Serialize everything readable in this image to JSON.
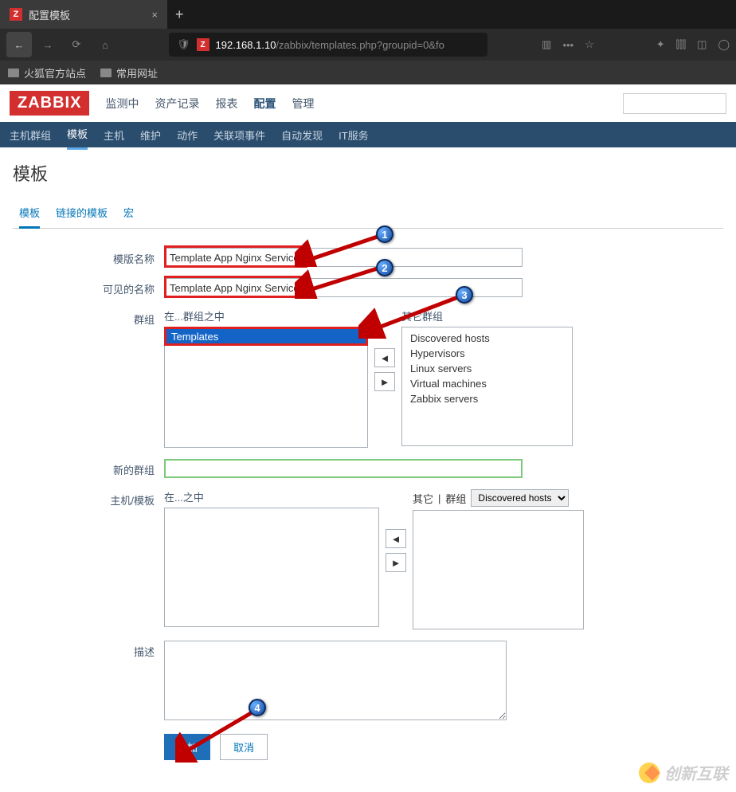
{
  "browser": {
    "tab_title": "配置模板",
    "url_host": "192.168.1.10",
    "url_path": "/zabbix/templates.php?groupid=0&fo",
    "bookmarks": [
      "火狐官方站点",
      "常用网址"
    ]
  },
  "zabbix": {
    "logo": "ZABBIX",
    "top_menu": [
      "监测中",
      "资产记录",
      "报表",
      "配置",
      "管理"
    ],
    "top_menu_active": 3,
    "sub_menu": [
      "主机群组",
      "模板",
      "主机",
      "维护",
      "动作",
      "关联项事件",
      "自动发现",
      "IT服务"
    ],
    "sub_menu_active": 1,
    "page_title": "模板",
    "form_tabs": [
      "模板",
      "链接的模板",
      "宏"
    ],
    "form_tabs_active": 0,
    "labels": {
      "template_name": "模版名称",
      "visible_name": "可见的名称",
      "groups": "群组",
      "in_groups": "在...群组之中",
      "other_groups": "其它群组",
      "new_group": "新的群组",
      "hosts_templates": "主机/模板",
      "in": "在...之中",
      "other": "其它",
      "group": "群组",
      "description": "描述"
    },
    "fields": {
      "template_name_value": "Template App Nginx Service",
      "visible_name_value": "Template App Nginx Service",
      "in_groups_items": [
        "Templates"
      ],
      "other_groups_items": [
        "Discovered hosts",
        "Hypervisors",
        "Linux servers",
        "Virtual machines",
        "Zabbix servers"
      ],
      "hosts_group_select": "Discovered hosts",
      "new_group_value": "",
      "description_value": ""
    },
    "buttons": {
      "add": "添加",
      "cancel": "取消"
    }
  },
  "annotations": {
    "c1": "1",
    "c2": "2",
    "c3": "3",
    "c4": "4"
  },
  "watermark": "创新互联"
}
